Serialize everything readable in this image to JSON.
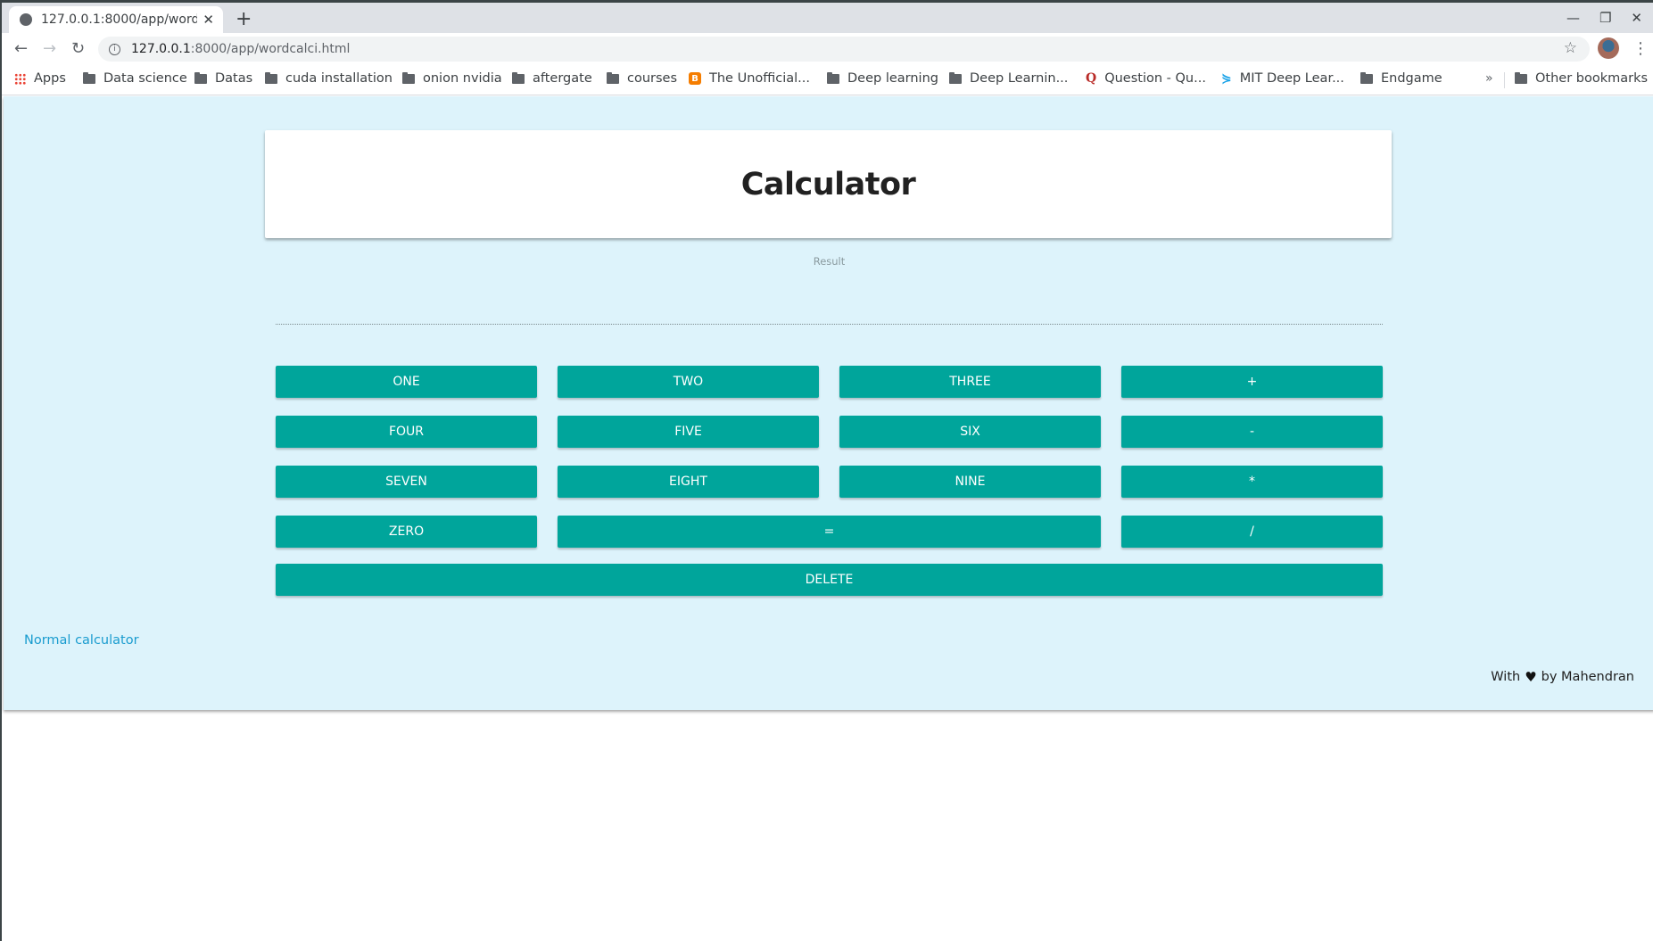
{
  "browser": {
    "tab_title": "127.0.0.1:8000/app/wordc",
    "new_tab_label": "+",
    "url_host": "127.0.0.1",
    "url_rest": ":8000/app/wordcalci.html",
    "window_controls": [
      "minimize-icon",
      "restore-icon",
      "close-icon"
    ],
    "bookmarks": [
      {
        "label": "Apps",
        "icon": "apps-grid-icon"
      },
      {
        "label": "Data science",
        "icon": "folder-icon"
      },
      {
        "label": "Datas",
        "icon": "folder-icon"
      },
      {
        "label": "cuda installation",
        "icon": "folder-icon"
      },
      {
        "label": "onion nvidia",
        "icon": "folder-icon"
      },
      {
        "label": "aftergate",
        "icon": "folder-icon"
      },
      {
        "label": "courses",
        "icon": "folder-icon"
      },
      {
        "label": "The Unofficial...",
        "icon": "blogger-icon"
      },
      {
        "label": "Deep learning",
        "icon": "folder-icon"
      },
      {
        "label": "Deep Learnin...",
        "icon": "folder-icon"
      },
      {
        "label": "Question - Qu...",
        "icon": "quora-icon"
      },
      {
        "label": "MIT Deep Lear...",
        "icon": "mit-icon"
      },
      {
        "label": "Endgame",
        "icon": "folder-icon"
      }
    ],
    "more_bookmarks": "»",
    "other_bookmarks": "Other bookmarks"
  },
  "page": {
    "title": "Calculator",
    "result_label": "Result",
    "result_value": "",
    "buttons": {
      "one": "ONE",
      "two": "TWO",
      "three": "THREE",
      "plus": "+",
      "four": "FOUR",
      "five": "FIVE",
      "six": "SIX",
      "minus": "-",
      "seven": "SEVEN",
      "eight": "EIGHT",
      "nine": "NINE",
      "multiply": "*",
      "zero": "ZERO",
      "equals": "=",
      "divide": "/",
      "delete": "DELETE"
    },
    "normal_calculator_link": "Normal calculator",
    "footer": {
      "prefix": "With",
      "heart": "♥",
      "suffix": "by Mahendran"
    },
    "colors": {
      "background": "#ddf3fb",
      "button": "#00a59b",
      "link": "#1a9ccf"
    }
  }
}
